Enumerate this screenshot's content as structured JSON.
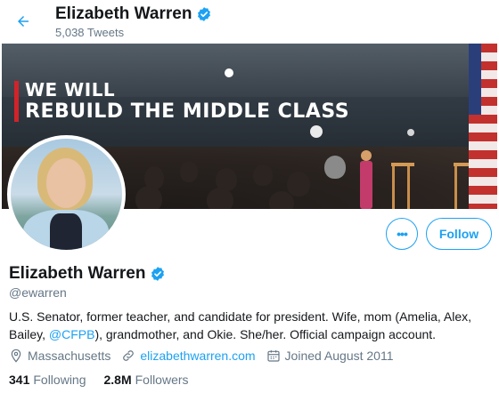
{
  "header": {
    "name": "Elizabeth Warren",
    "tweet_count": "5,038 Tweets"
  },
  "banner": {
    "line1": "WE WILL",
    "line2": "REBUILD THE MIDDLE CLASS"
  },
  "actions": {
    "more_label": "•••",
    "follow_label": "Follow"
  },
  "profile": {
    "name": "Elizabeth Warren",
    "handle": "@ewarren",
    "bio_part1": "U.S. Senator, former teacher, and candidate for president. Wife, mom (Amelia, Alex, Bailey, ",
    "bio_mention": "@CFPB",
    "bio_part2": "), grandmother, and Okie. She/her. Official campaign account.",
    "location": "Massachusetts",
    "website": "elizabethwarren.com",
    "joined": "Joined August 2011",
    "following_count": "341",
    "following_label": "Following",
    "followers_count": "2.8M",
    "followers_label": "Followers"
  },
  "colors": {
    "accent": "#1da1f2",
    "secondary_text": "#657786",
    "slogan_bar": "#d2232a"
  },
  "icons": [
    "back-arrow-icon",
    "verified-badge-icon",
    "location-pin-icon",
    "link-icon",
    "calendar-icon"
  ]
}
